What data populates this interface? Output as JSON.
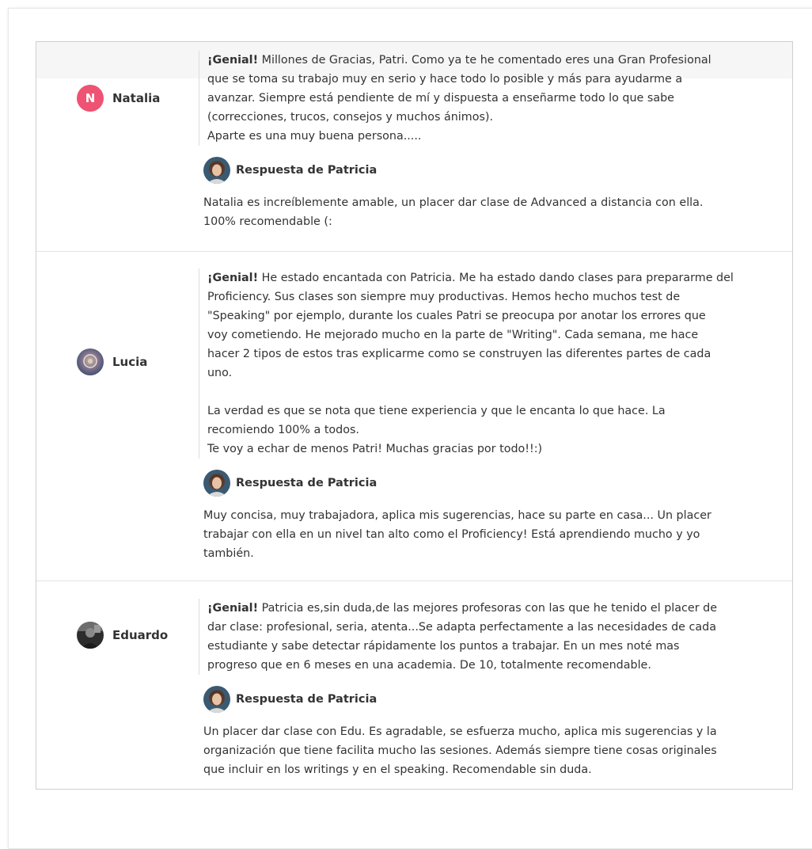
{
  "reviews": [
    {
      "student_name": "Natalia",
      "avatar_initial": "N",
      "avatar_type": "initial",
      "rating_label": "¡Genial!",
      "review_lines": [
        " Millones de Gracias, Patri. Como ya te he comentado eres una Gran Profesional",
        "que se toma su trabajo muy en serio y hace todo lo posible y más para ayudarme a",
        "avanzar. Siempre está pendiente de mí y dispuesta a enseñarme todo lo que sabe",
        "(correcciones, trucos, consejos y muchos ánimos).",
        "Aparte es una muy buena persona....."
      ],
      "response_title": "Respuesta de Patricia",
      "response_lines": [
        "Natalia es increíblemente amable, un placer dar clase de Advanced a distancia con ella.",
        "100% recomendable (:"
      ]
    },
    {
      "student_name": "Lucia",
      "avatar_type": "photo",
      "rating_label": "¡Genial!",
      "review_lines": [
        " He estado encantada con Patricia. Me ha estado dando clases para prepararme del",
        "Proficiency. Sus clases son siempre muy productivas. Hemos hecho muchos test de",
        "\"Speaking\" por ejemplo, durante los cuales Patri se preocupa por anotar los errores que",
        "voy cometiendo. He mejorado mucho en la parte de \"Writing\". Cada semana, me hace",
        "hacer 2 tipos de estos tras explicarme como se construyen las diferentes partes de cada",
        "uno.",
        "",
        "La verdad es que se nota que tiene experiencia y que le encanta lo que hace. La",
        "recomiendo 100% a todos.",
        "Te voy a echar de menos Patri! Muchas gracias por todo!!:)"
      ],
      "response_title": "Respuesta de Patricia",
      "response_lines": [
        "Muy concisa, muy trabajadora, aplica mis sugerencias, hace su parte en casa... Un placer",
        "trabajar con ella en un nivel tan alto como el Proficiency! Está aprendiendo mucho y yo",
        "también."
      ]
    },
    {
      "student_name": "Eduardo",
      "avatar_type": "photo",
      "rating_label": "¡Genial!",
      "review_lines": [
        " Patricia es,sin duda,de las mejores profesoras con las que he tenido el placer de",
        "dar clase: profesional, seria, atenta...Se adapta perfectamente a las necesidades de cada",
        "estudiante y sabe detectar rápidamente los puntos a trabajar. En un mes noté mas",
        "progreso que en 6 meses en una academia. De 10, totalmente recomendable."
      ],
      "response_title": "Respuesta de Patricia",
      "response_lines": [
        "Un placer dar clase con Edu. Es agradable, se esfuerza mucho, aplica mis sugerencias y la",
        "organización que tiene facilita mucho las sesiones. Además siempre tiene cosas originales",
        "que incluir en los writings y en el speaking. Recomendable sin duda."
      ]
    }
  ],
  "colors": {
    "initial_avatar": "#ee5373",
    "border": "#cfcfcf",
    "text": "#333333"
  }
}
